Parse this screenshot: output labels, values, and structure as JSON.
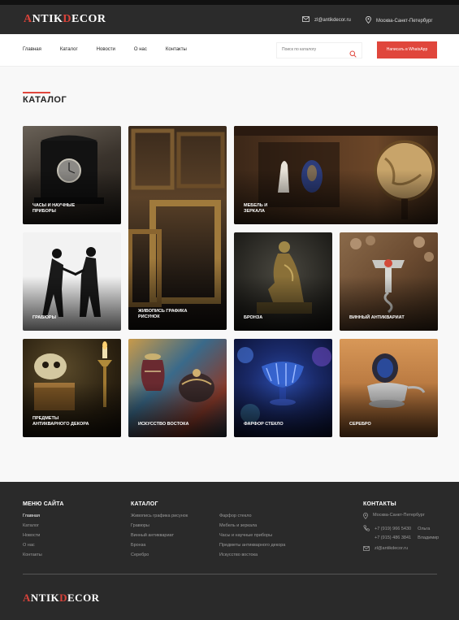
{
  "header": {
    "logo": {
      "a": "A",
      "ntik": "NTIK",
      "d": "D",
      "ecor": "ECOR"
    },
    "email": "zl@antikdecor.ru",
    "location": "Москва-Санкт-Петербург"
  },
  "nav": [
    "Главная",
    "Каталог",
    "Новости",
    "О нас",
    "Контакты"
  ],
  "search": {
    "placeholder": "Поиск по каталогу"
  },
  "whatsapp_button": "Написать в WhatsApp",
  "catalog": {
    "title": "КАТАЛОГ",
    "tiles": [
      {
        "label": "ЧАСЫ И НАУЧНЫЕ\nПРИБОРЫ",
        "theme": "clock"
      },
      {
        "label": "ЖИВОПИСЬ ГРАФИКА\nРИСУНОК",
        "theme": "frames"
      },
      {
        "label": "МЕБЕЛЬ И\nЗЕРКАЛА",
        "theme": "furniture"
      },
      {
        "label": "ГРАВЮРЫ",
        "theme": "engraving"
      },
      {
        "label": "БРОНЗА",
        "theme": "bronze"
      },
      {
        "label": "ВИННЫЙ АНТИКВАРИАТ",
        "theme": "wine"
      },
      {
        "label": "ПРЕДМЕТЫ\nАНТИКВАРНОГО ДЕКОРА",
        "theme": "decor"
      },
      {
        "label": "ИСКУССТВО ВОСТОКА",
        "theme": "east"
      },
      {
        "label": "ФАРФОР СТЕКЛО",
        "theme": "glass"
      },
      {
        "label": "СЕРЕБРО",
        "theme": "silver"
      }
    ]
  },
  "footer": {
    "menu_title": "МЕНЮ САЙТА",
    "menu": [
      "Главная",
      "Каталог",
      "Новости",
      "О нас",
      "Контакты"
    ],
    "catalog_title": "КАТАЛОГ",
    "catalog_col1": [
      "Живопись графика рисунок",
      "Гравюры",
      "Винный антиквариат",
      "Бронза",
      "Серебро"
    ],
    "catalog_col2": [
      "Фарфор стекло",
      "Мебель и зеркала",
      "Часы и научные приборы",
      "Предметы антикварного декора",
      "Искусство востока"
    ],
    "contacts_title": "КОНТАКТЫ",
    "location": "Москва-Санкт-Петербург",
    "phone1": "+7 (919) 966 5430",
    "phone1_name": "Ольга",
    "phone2": "+7 (915) 486 3841",
    "phone2_name": "Владимир",
    "email": "zl@antikdecor.ru"
  },
  "colors": {
    "accent": "#e0463c",
    "dark": "#2b2b2b"
  }
}
